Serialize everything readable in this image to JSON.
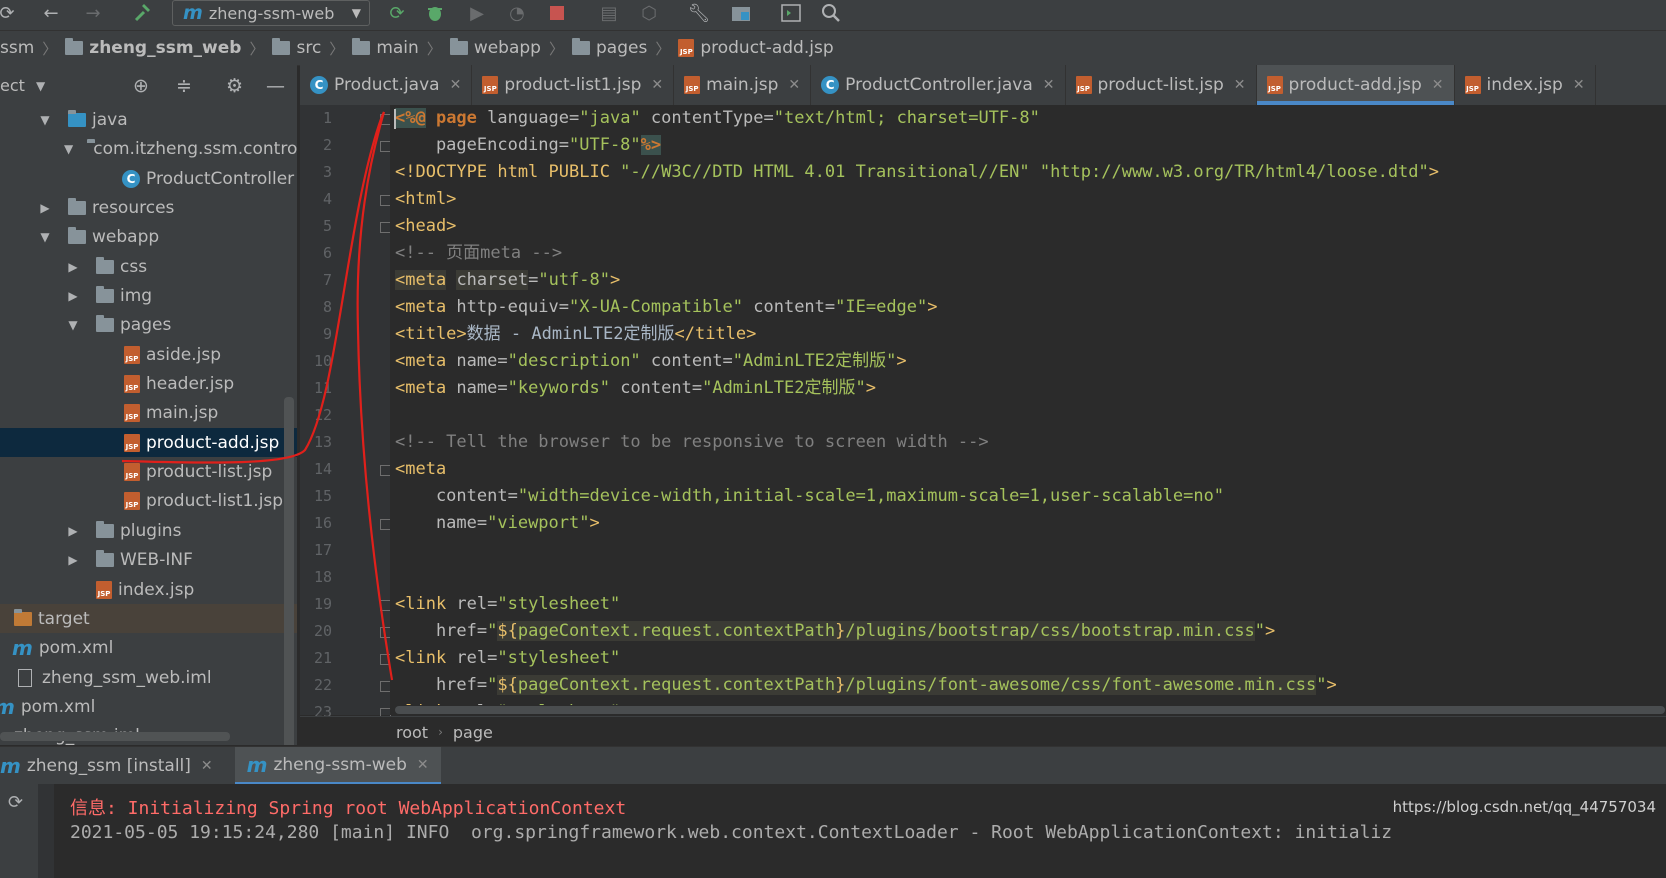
{
  "toolbar": {
    "run_config": "zheng-ssm-web",
    "icons": [
      "back-arrow-icon",
      "forward-arrow-icon",
      "build-hammer-icon",
      "rerun-icon",
      "debug-bug-icon",
      "coverage-icon",
      "profile-icon",
      "stop-icon",
      "dump-icon",
      "attach-icon",
      "settings-wrench-icon",
      "project-structure-icon",
      "terminal-icon",
      "search-icon"
    ]
  },
  "navbar": {
    "crumbs": [
      "ssm",
      "zheng_ssm_web",
      "src",
      "main",
      "webapp",
      "pages",
      "product-add.jsp"
    ]
  },
  "project": {
    "header_label": "ect",
    "tree": [
      {
        "label": "java",
        "kind": "folder-blue",
        "expanded": true
      },
      {
        "label": "com.itzheng.ssm.contro",
        "kind": "package",
        "expanded": true
      },
      {
        "label": "ProductController",
        "kind": "class"
      },
      {
        "label": "resources",
        "kind": "folder",
        "expanded": false
      },
      {
        "label": "webapp",
        "kind": "folder",
        "expanded": true
      },
      {
        "label": "css",
        "kind": "folder",
        "expanded": false
      },
      {
        "label": "img",
        "kind": "folder",
        "expanded": false
      },
      {
        "label": "pages",
        "kind": "folder",
        "expanded": true
      },
      {
        "label": "aside.jsp",
        "kind": "jsp"
      },
      {
        "label": "header.jsp",
        "kind": "jsp"
      },
      {
        "label": "main.jsp",
        "kind": "jsp"
      },
      {
        "label": "product-add.jsp",
        "kind": "jsp",
        "selected": true
      },
      {
        "label": "product-list.jsp",
        "kind": "jsp"
      },
      {
        "label": "product-list1.jsp",
        "kind": "jsp"
      },
      {
        "label": "plugins",
        "kind": "folder",
        "expanded": false
      },
      {
        "label": "WEB-INF",
        "kind": "folder",
        "expanded": false
      },
      {
        "label": "index.jsp",
        "kind": "jsp"
      },
      {
        "label": "target",
        "kind": "folder-orange"
      },
      {
        "label": "pom.xml",
        "kind": "maven"
      },
      {
        "label": "zheng_ssm_web.iml",
        "kind": "iml"
      },
      {
        "label": "pom.xml",
        "kind": "maven"
      },
      {
        "label": "zheng_ssm.iml",
        "kind": "iml"
      }
    ]
  },
  "tabs": [
    {
      "label": "Product.java",
      "kind": "class"
    },
    {
      "label": "product-list1.jsp",
      "kind": "jsp"
    },
    {
      "label": "main.jsp",
      "kind": "jsp"
    },
    {
      "label": "ProductController.java",
      "kind": "class"
    },
    {
      "label": "product-list.jsp",
      "kind": "jsp"
    },
    {
      "label": "product-add.jsp",
      "kind": "jsp",
      "active": true
    },
    {
      "label": "index.jsp",
      "kind": "jsp"
    }
  ],
  "line_numbers": [
    "1",
    "2",
    "3",
    "4",
    "5",
    "6",
    "7",
    "8",
    "9",
    "10",
    "11",
    "12",
    "13",
    "14",
    "15",
    "16",
    "17",
    "18",
    "19",
    "20",
    "21",
    "22",
    "23"
  ],
  "code": {
    "l1a": "<%@",
    "l1b": " page",
    "l1c": " language=",
    "l1d": "\"java\"",
    "l1e": " contentType=",
    "l1f": "\"text/html; charset=UTF-8\"",
    "l2a": "    pageEncoding=",
    "l2b": "\"UTF-8\"",
    "l2c": "%>",
    "l3a": "<!DOCTYPE html PUBLIC ",
    "l3b": "\"-//W3C//DTD HTML 4.01 Transitional//EN\"",
    "l3c": " ",
    "l3d": "\"http://www.w3.org/TR/html4/loose.dtd\"",
    "l3e": ">",
    "l4": "<html>",
    "l5": "<head>",
    "l6": "<!-- 页面meta -->",
    "l7a": "<meta",
    "l7b": " ",
    "l7c": "charset",
    "l7d": "=",
    "l7e": "\"utf-8\"",
    "l7f": ">",
    "l8a": "<meta",
    "l8b": " http-equiv=",
    "l8c": "\"X-UA-Compatible\"",
    "l8d": " content=",
    "l8e": "\"IE=edge\"",
    "l8f": ">",
    "l9a": "<title>",
    "l9b": "数据 - AdminLTE2定制版",
    "l9c": "</title>",
    "l10a": "<meta",
    "l10b": " name=",
    "l10c": "\"description\"",
    "l10d": " content=",
    "l10e": "\"AdminLTE2定制版\"",
    "l10f": ">",
    "l11a": "<meta",
    "l11b": " name=",
    "l11c": "\"keywords\"",
    "l11d": " content=",
    "l11e": "\"AdminLTE2定制版\"",
    "l11f": ">",
    "l13": "<!-- Tell the browser to be responsive to screen width -->",
    "l14": "<meta",
    "l15a": "    content=",
    "l15b": "\"width=device-width,initial-scale=1,maximum-scale=1,user-scalable=no\"",
    "l16a": "    name=",
    "l16b": "\"viewport\"",
    "l16c": ">",
    "l19a": "<link",
    "l19b": " rel=",
    "l19c": "\"stylesheet\"",
    "l20a": "    href=",
    "l20b": "\"",
    "l20c": "${",
    "l20d": "pageContext.request.contextPath",
    "l20e": "}",
    "l20f": "/plugins/bootstrap/css/bootstrap.min.css",
    "l20g": "\"",
    "l20h": ">",
    "l21a": "<link",
    "l21b": " rel=",
    "l21c": "\"stylesheet\"",
    "l22a": "    href=",
    "l22b": "\"",
    "l22c": "${",
    "l22d": "pageContext.request.contextPath",
    "l22e": "}",
    "l22f": "/plugins/font-awesome/css/font-awesome.min.css",
    "l22g": "\"",
    "l22h": ">",
    "l23a": "<link",
    "l23b": " rel=",
    "l23c": "\"stylesheet\""
  },
  "breadcrumb_bottom": [
    "root",
    "page"
  ],
  "run_tabs": [
    {
      "label": "zheng_ssm [install]"
    },
    {
      "label": "zheng-ssm-web",
      "active": true
    }
  ],
  "console": {
    "line1": "信息: Initializing Spring root WebApplicationContext",
    "line2": "2021-05-05 19:15:24,280 [main] INFO  org.springframework.web.context.ContextLoader - Root WebApplicationContext: initializ"
  },
  "watermark": "https://blog.csdn.net/qq_44757034",
  "colors": {
    "accent": "#4a88c7",
    "selection": "#0d293e",
    "annotation": "#e0201b"
  }
}
